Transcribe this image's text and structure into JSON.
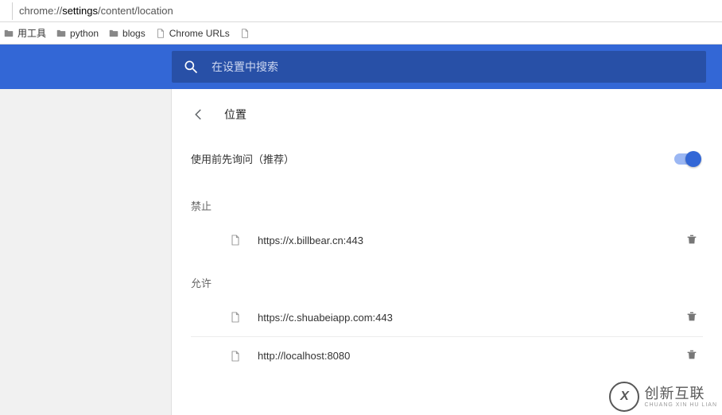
{
  "address_bar": {
    "prefix": "chrome://",
    "bold": "settings",
    "suffix": "/content/location"
  },
  "bookmarks": {
    "items": [
      {
        "label": "用工具",
        "icon": "folder"
      },
      {
        "label": "python",
        "icon": "folder"
      },
      {
        "label": "blogs",
        "icon": "folder"
      },
      {
        "label": "Chrome URLs",
        "icon": "doc"
      },
      {
        "label": "",
        "icon": "doc"
      }
    ]
  },
  "search": {
    "placeholder": "在设置中搜索"
  },
  "page": {
    "title": "位置",
    "toggle_label": "使用前先询问（推荐）",
    "toggle_on": true,
    "block_label": "禁止",
    "allow_label": "允许",
    "block_list": [
      {
        "url": "https://x.billbear.cn:443"
      }
    ],
    "allow_list": [
      {
        "url": "https://c.shuabeiapp.com:443"
      },
      {
        "url": "http://localhost:8080"
      }
    ]
  },
  "watermark": {
    "big": "创新互联",
    "small": "CHUANG XIN HU LIAN",
    "logo": "X"
  }
}
